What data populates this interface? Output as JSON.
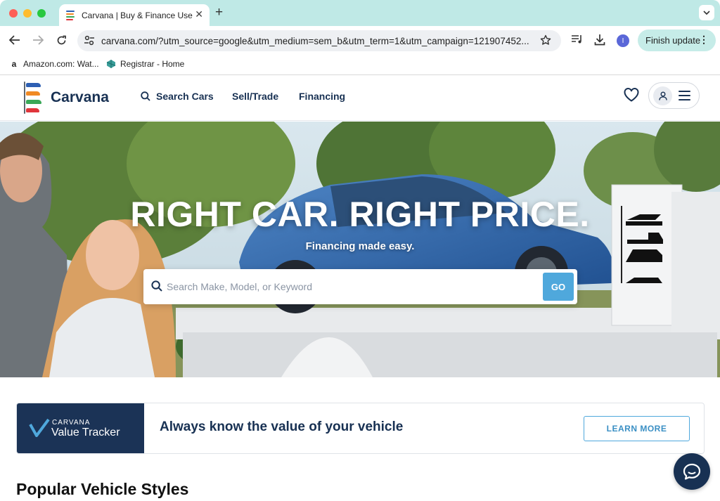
{
  "browser": {
    "tab_title": "Carvana | Buy & Finance Used Cars Online",
    "url": "carvana.com/?utm_source=google&utm_medium=sem_b&utm_term=1&utm_campaign=121907452...",
    "profile_initial": "I",
    "finish_update_label": "Finish update",
    "bookmarks": [
      {
        "label": "Amazon.com: Wat...",
        "icon": "amazon-icon"
      },
      {
        "label": "Registrar - Home",
        "icon": "registrar-icon"
      }
    ]
  },
  "header": {
    "logo_text": "Carvana",
    "nav": {
      "search_cars": "Search Cars",
      "sell_trade": "Sell/Trade",
      "financing": "Financing"
    }
  },
  "hero": {
    "title": "RIGHT CAR. RIGHT PRICE.",
    "subtitle": "Financing made easy.",
    "search_placeholder": "Search Make, Model, or Keyword",
    "go_label": "GO"
  },
  "value_tracker": {
    "brand_top": "CARVANA",
    "brand_bottom": "Value Tracker",
    "headline": "Always know the value of your vehicle",
    "button_label": "LEARN MORE"
  },
  "sections": {
    "popular_styles_title": "Popular Vehicle Styles"
  },
  "colors": {
    "brand_navy": "#183153",
    "accent_blue": "#4fa8dc",
    "chrome_teal": "#bfe9e6"
  }
}
